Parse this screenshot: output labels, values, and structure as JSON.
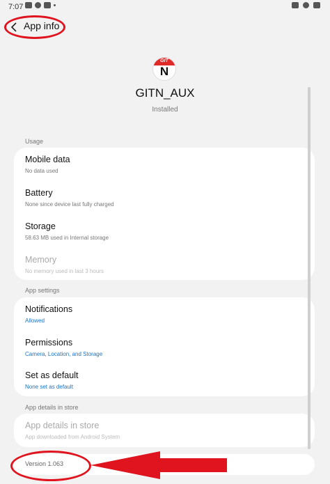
{
  "status_bar": {
    "time": "7:07",
    "left_icons": [
      "notification-icon",
      "cloud-icon",
      "youtube-icon",
      "dot-icon"
    ],
    "right_icons": [
      "mute-icon",
      "wifi-icon",
      "battery-icon"
    ]
  },
  "top_bar": {
    "title": "App info",
    "back_icon": "chevron-left-icon"
  },
  "app": {
    "icon_letters_top": "GIT",
    "icon_letter_main": "N",
    "icon_colors": {
      "band": "#e02a2a",
      "letter": "#111111"
    },
    "name": "GITN_AUX",
    "status": "Installed"
  },
  "sections": {
    "usage": {
      "header": "Usage",
      "items": [
        {
          "title": "Mobile data",
          "sub": "No data used"
        },
        {
          "title": "Battery",
          "sub": "None since device last fully charged"
        },
        {
          "title": "Storage",
          "sub": "58.63 MB used in Internal storage"
        },
        {
          "title": "Memory",
          "sub": "No memory used in last 3 hours"
        }
      ]
    },
    "app_settings": {
      "header": "App settings",
      "items": [
        {
          "title": "Notifications",
          "sub": "Allowed"
        },
        {
          "title": "Permissions",
          "sub": "Camera, Location, and Storage"
        },
        {
          "title": "Set as default",
          "sub": "None set as default"
        }
      ]
    },
    "store": {
      "header": "App details in store",
      "items": [
        {
          "title": "App details in store",
          "sub": "App downloaded from Android System"
        }
      ]
    }
  },
  "version": "Version 1.063",
  "colors": {
    "accent_blue": "#1a73c7",
    "annotation_red": "#e0141e",
    "background": "#f2f2f2"
  }
}
